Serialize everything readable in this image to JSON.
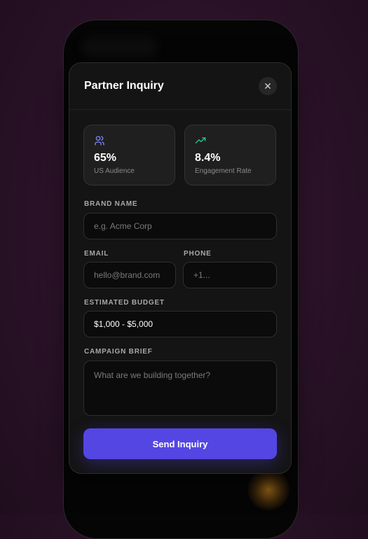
{
  "modal": {
    "title": "Partner Inquiry",
    "close_icon": "close-icon"
  },
  "stats": [
    {
      "icon": "users-icon",
      "icon_color": "#7f87ff",
      "value": "65%",
      "label": "US Audience"
    },
    {
      "icon": "trending-up-icon",
      "icon_color": "#2ec68a",
      "value": "8.4%",
      "label": "Engagement Rate"
    }
  ],
  "form": {
    "brand_name": {
      "label": "BRAND NAME",
      "placeholder": "e.g. Acme Corp",
      "value": ""
    },
    "email": {
      "label": "EMAIL",
      "placeholder": "hello@brand.com",
      "value": ""
    },
    "phone": {
      "label": "PHONE",
      "placeholder": "+1...",
      "value": ""
    },
    "budget": {
      "label": "ESTIMATED BUDGET",
      "value": "$1,000 - $5,000"
    },
    "brief": {
      "label": "CAMPAIGN BRIEF",
      "placeholder": "What are we building together?",
      "value": ""
    }
  },
  "submit_label": "Send Inquiry",
  "colors": {
    "accent": "#5446e3",
    "background": "#141414"
  }
}
